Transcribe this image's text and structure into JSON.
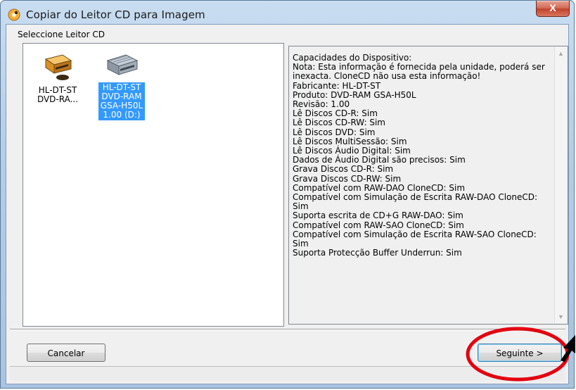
{
  "window": {
    "title": "Copiar do Leitor CD para Imagem",
    "close_glyph": "X"
  },
  "drive_selection": {
    "group_label": "Seleccione Leitor CD",
    "drives": [
      {
        "label": "HL-DT-ST DVD-RA...",
        "icon": "optical-drive-icon",
        "selected": false
      },
      {
        "label": "HL-DT-ST DVD-RAM GSA-H50L 1.00 (D:)",
        "icon": "optical-drive-icon",
        "selected": true
      }
    ]
  },
  "device_info": {
    "lines": [
      "Capacidades do Dispositivo:",
      "Nota: Esta informação é fornecida pela unidade, poderá ser inexacta. CloneCD não usa esta informação!",
      "Fabricante: HL-DT-ST",
      "Produto: DVD-RAM GSA-H50L",
      "Revisão: 1.00",
      "Lê Discos CD-R: Sim",
      "Lê Discos CD-RW: Sim",
      "Lê Discos DVD: Sim",
      "Lê Discos MultiSessão: Sim",
      "Lê Discos Áudio Digital: Sim",
      "Dados de Áudio Digital são precisos: Sim",
      "Grava Discos CD-R: Sim",
      "Grava Discos CD-RW: Sim",
      "Compatível com RAW-DAO CloneCD: Sim",
      "Compatível com Simulação de Escrita RAW-DAO CloneCD: Sim",
      "Suporta escrita de CD+G RAW-DAO: Sim",
      "Compatível com RAW-SAO CloneCD: Sim",
      "Compatível com Simulação de Escrita RAW-SAO CloneCD: Sim",
      "Suporta Protecção Buffer Underrun: Sim"
    ]
  },
  "buttons": {
    "cancel": "Cancelar",
    "next": "Seguinte >"
  },
  "colors": {
    "selection": "#3399ff",
    "annotation_circle": "#e3000f",
    "annotation_arrow": "#000000"
  }
}
